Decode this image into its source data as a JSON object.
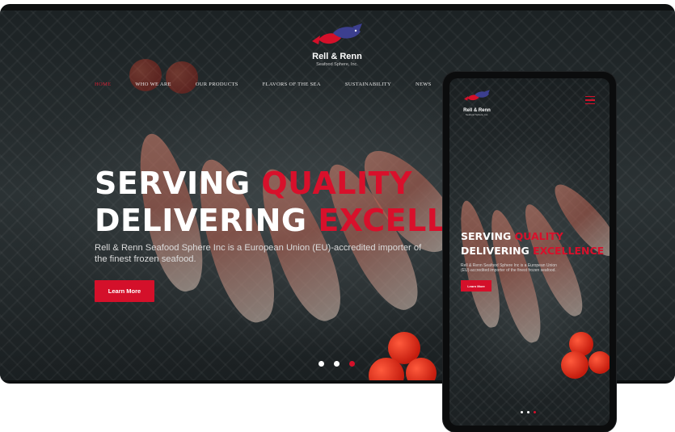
{
  "brand": {
    "name": "Rell & Renn",
    "tagline": "Seafood Sphere, Inc."
  },
  "nav": {
    "items": [
      "HOME",
      "WHO WE ARE",
      "OUR PRODUCTS",
      "FLAVORS OF THE SEA",
      "SUSTAINABILITY",
      "NEWS"
    ],
    "active": "HOME"
  },
  "hero": {
    "line1_white": "SERVING ",
    "line1_red": "QUALITY",
    "line2_white": "DELIVERING ",
    "line2_red": "EXCELLENCE",
    "desktop_line2_red": "EXCELLE",
    "description": "Rell & Renn Seafood Sphere Inc is a European Union (EU)-accredited importer of the finest frozen seafood.",
    "cta": "Learn More"
  },
  "slider": {
    "count": 3,
    "active_index": 3
  },
  "colors": {
    "accent": "#d4102a",
    "dark": "#0d0f10",
    "text": "#ffffff"
  },
  "icons": {
    "logo": "fish-logo-icon",
    "menu": "hamburger-menu-icon"
  }
}
